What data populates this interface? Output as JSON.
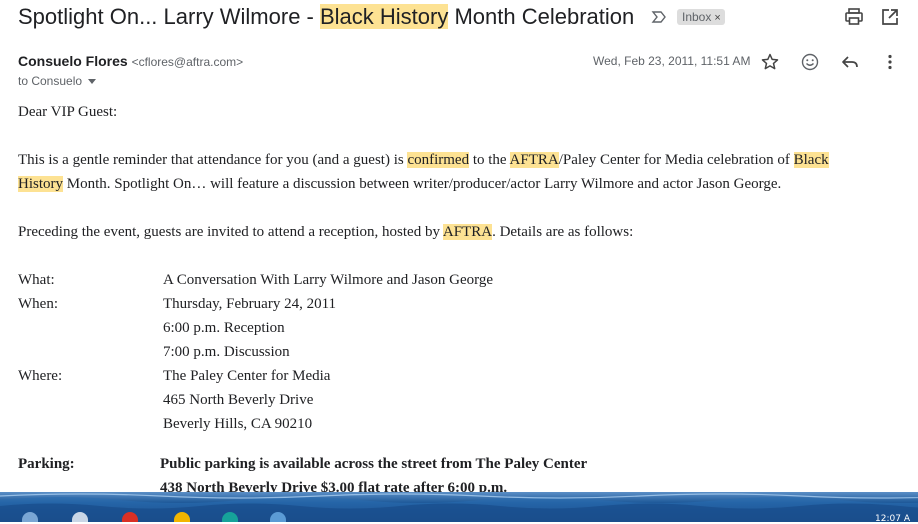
{
  "email": {
    "subject": {
      "part1": "Spotlight On... Larry Wilmore - ",
      "highlight": "Black History",
      "part2": " Month Celebration"
    },
    "label_badge": "Inbox",
    "label_remove": "×",
    "sender": {
      "name": "Consuelo Flores",
      "email": "<cflores@aftra.com>"
    },
    "recipient": "to Consuelo",
    "date": "Wed, Feb 23, 2011, 11:51 AM"
  },
  "body": {
    "greeting": "Dear VIP Guest:",
    "p1": {
      "t1": "This is a gentle reminder that attendance for you (and a guest) is ",
      "h1": "confirmed",
      "t2": " to the ",
      "h2": "AFTRA",
      "t3": "/Paley Center for Media celebration of ",
      "h3": "Black",
      "h4": "History",
      "t4": " Month.  Spotlight On… will feature a discussion between writer/producer/actor Larry Wilmore and actor Jason George."
    },
    "p2": {
      "t1": "Preceding the event, guests are invited to attend a reception, hosted by ",
      "h1": "AFTRA",
      "t2": ".  Details are as follows:"
    },
    "details": {
      "what_label": "What:",
      "what": "A Conversation With Larry Wilmore and Jason George",
      "when_label": "When:",
      "when1": "Thursday, February 24, 2011",
      "when2": "6:00 p.m. Reception",
      "when3": "7:00 p.m. Discussion",
      "where_label": "Where:",
      "where1": "The Paley Center for Media",
      "where2": "465 North Beverly Drive",
      "where3": "Beverly Hills, CA 90210",
      "parking_label": "Parking:",
      "parking1": "Public parking is available across the street from The Paley Center",
      "parking2": "438 North Beverly Drive  $3.00 flat rate after 6:00 p.m."
    }
  },
  "taskbar": {
    "clock": "12:07 A"
  },
  "icons": {
    "important": "importance-marker-icon",
    "print": "print-icon",
    "open_new": "open-in-new-window-icon",
    "star": "star-icon",
    "emoji": "add-reaction-icon",
    "reply": "reply-icon",
    "more": "more-vertical-icon"
  },
  "colors": {
    "highlight": "#fde293",
    "badge": "#dddddd",
    "taskbar": "#1f5a9a"
  }
}
